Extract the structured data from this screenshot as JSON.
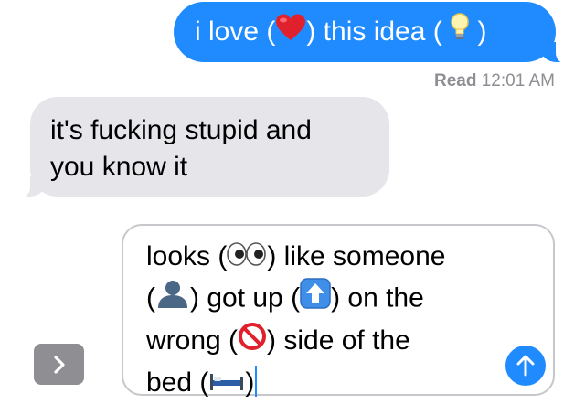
{
  "conversation": {
    "sent_message": {
      "part1": "i love (",
      "part2": ") this idea (",
      "part3": ")",
      "emoji_1": "heart-emoji",
      "emoji_2": "lightbulb-emoji"
    },
    "read_receipt": {
      "label": "Read",
      "time": "12:01 AM"
    },
    "received_message": {
      "line1": "it's fucking stupid and",
      "line2": "you know it"
    }
  },
  "composer": {
    "draft": {
      "seg1": "looks (",
      "seg2": ") like someone",
      "seg3": "(",
      "seg4": ") got up (",
      "seg5": ") on the",
      "seg6": "wrong (",
      "seg7": ") side of the",
      "seg8": "bed (",
      "seg9": ")"
    },
    "emojis": [
      "eyes-emoji",
      "person-silhouette-emoji",
      "up-arrow-emoji",
      "no-entry-emoji",
      "bed-emoji"
    ]
  },
  "colors": {
    "sent_bubble": "#1f8bff",
    "received_bubble": "#e5e5ea",
    "secondary_text": "#8e8e93",
    "expand_button": "#8e8e93",
    "send_button": "#1f8bff"
  }
}
